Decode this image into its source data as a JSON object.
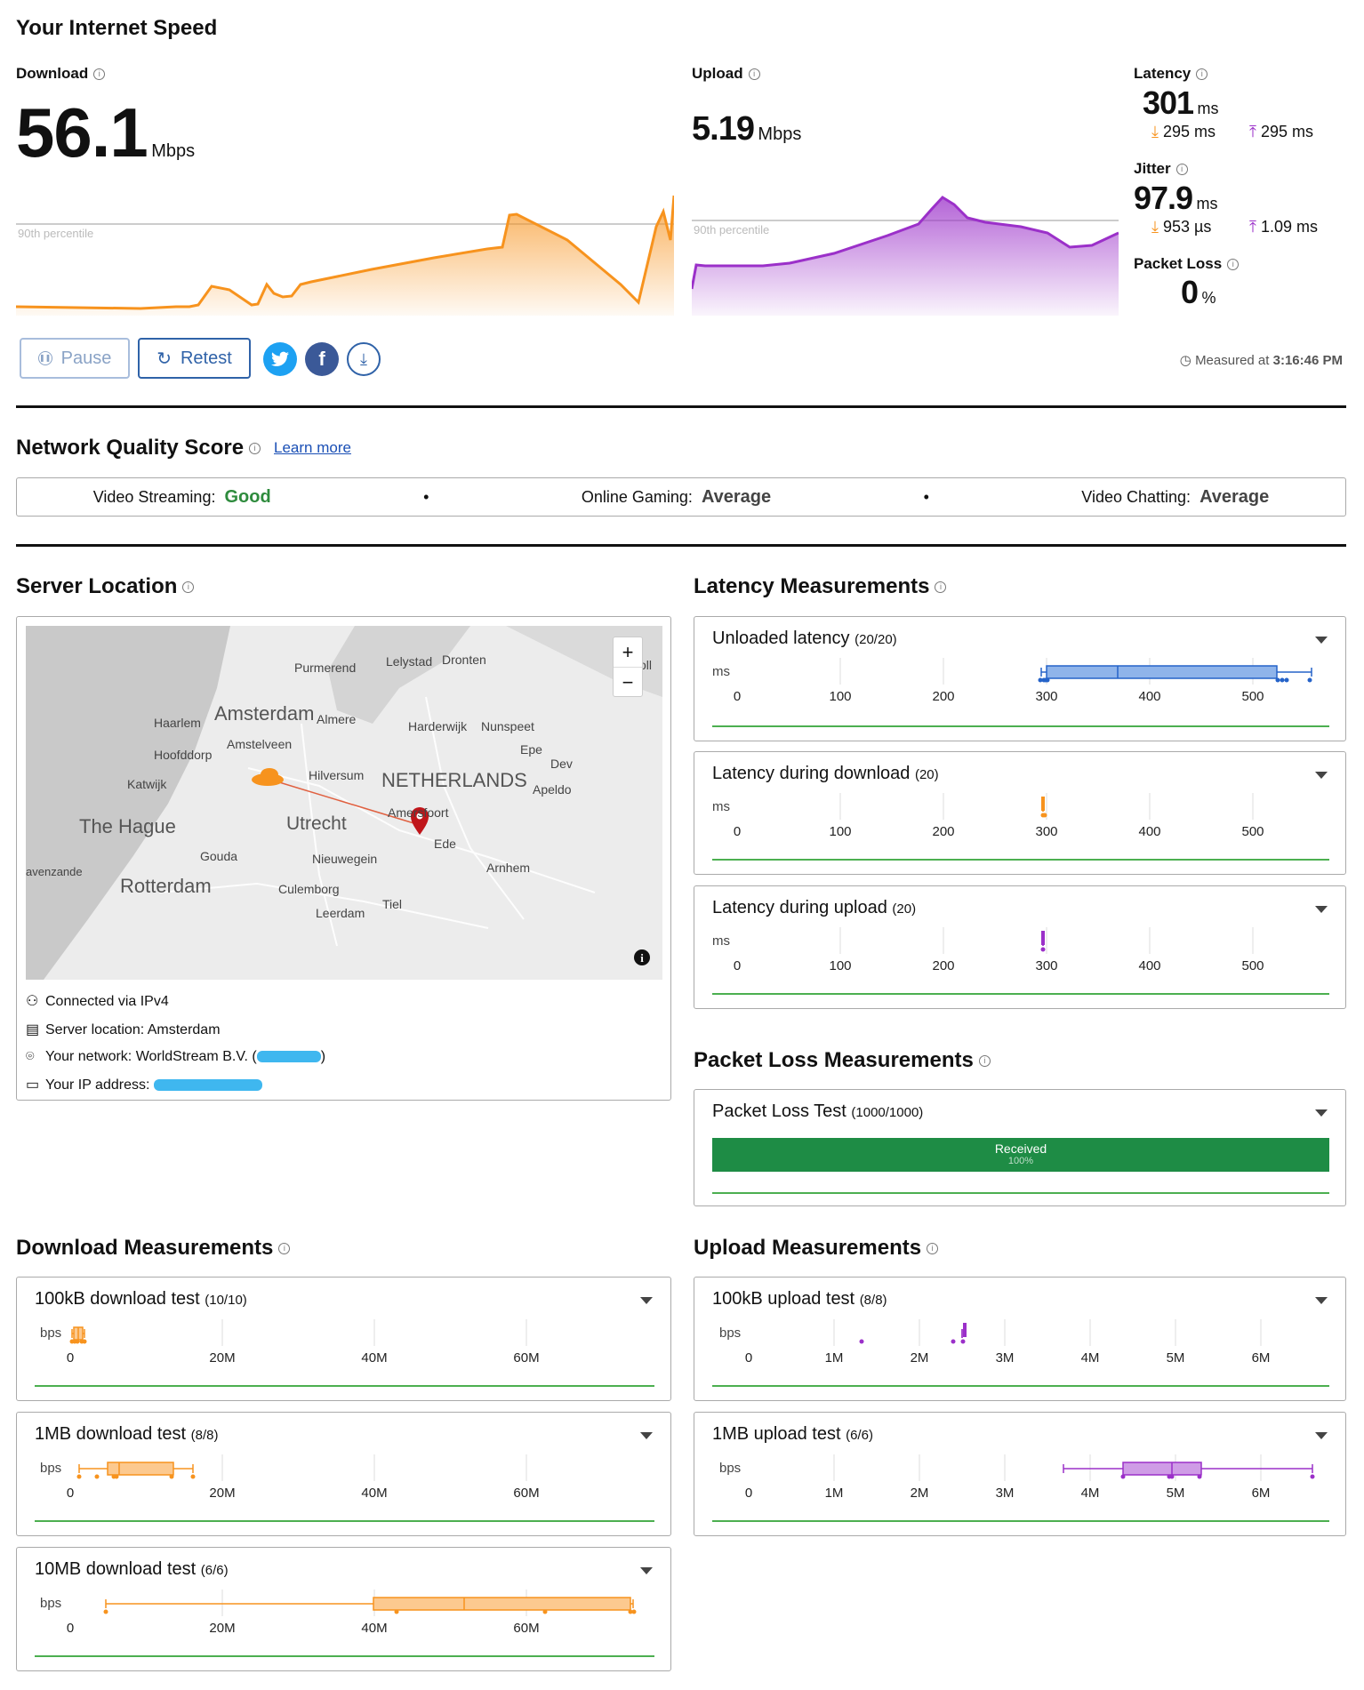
{
  "header": {
    "title": "Your Internet Speed",
    "download_label": "Download",
    "download_value": "56.1",
    "download_unit": "Mbps",
    "upload_label": "Upload",
    "upload_value": "5.19",
    "upload_unit": "Mbps",
    "percentile_label": "90th percentile",
    "latency_label": "Latency",
    "latency_value": "301",
    "latency_unit": "ms",
    "latency_down": "295 ms",
    "latency_up": "295 ms",
    "jitter_label": "Jitter",
    "jitter_value": "97.9",
    "jitter_unit": "ms",
    "jitter_down": "953 µs",
    "jitter_up": "1.09 ms",
    "packet_loss_label": "Packet Loss",
    "packet_loss_value": "0",
    "packet_loss_unit": "%",
    "pause_label": "Pause",
    "retest_label": "Retest",
    "measured_label": "Measured at",
    "measured_time": "3:16:46 PM"
  },
  "nqs": {
    "title": "Network Quality Score",
    "learn_more": "Learn more",
    "items": [
      {
        "label": "Video Streaming:",
        "value": "Good",
        "color": "#2e8b3d"
      },
      {
        "label": "Online Gaming:",
        "value": "Average",
        "color": "#444444"
      },
      {
        "label": "Video Chatting:",
        "value": "Average",
        "color": "#444444"
      }
    ]
  },
  "server": {
    "title": "Server Location",
    "map_labels": [
      "Purmerend",
      "Lelystad",
      "Dronten",
      "Haarlem",
      "Amsterdam",
      "Almere",
      "Harderwijk",
      "Nunspeet",
      "Hoofddorp",
      "Amstelveen",
      "Epe",
      "Katwijk",
      "Hilversum",
      "NETHERLANDS",
      "Apeldo",
      "Dev",
      "The Hague",
      "Utrecht",
      "Amersfoort",
      "Ede",
      "Gouda",
      "Nieuwegein",
      "avenzande",
      "Rotterdam",
      "Culemborg",
      "Arnhem",
      "Tiel",
      "Leerdam",
      "oll"
    ],
    "zoom_in": "+",
    "zoom_out": "−",
    "connected": "Connected via IPv4",
    "location": "Server location: Amsterdam",
    "network_prefix": "Your network: WorldStream B.V. (",
    "network_suffix": ")",
    "ip_prefix": "Your IP address:"
  },
  "latency": {
    "title": "Latency Measurements",
    "axis_unit": "ms",
    "ticks": [
      "0",
      "100",
      "200",
      "300",
      "400",
      "500"
    ],
    "cards": [
      {
        "title": "Unloaded latency",
        "count": "(20/20)"
      },
      {
        "title": "Latency during download",
        "count": "(20)"
      },
      {
        "title": "Latency during upload",
        "count": "(20)"
      }
    ]
  },
  "packet_loss": {
    "title": "Packet Loss Measurements",
    "card_title": "Packet Loss Test",
    "card_count": "(1000/1000)",
    "bar_label": "Received",
    "bar_pct": "100%",
    "received_fraction": 1.0
  },
  "download": {
    "title": "Download Measurements",
    "axis_unit": "bps",
    "ticks": [
      "0",
      "20M",
      "40M",
      "60M"
    ],
    "cards": [
      {
        "title": "100kB download test",
        "count": "(10/10)"
      },
      {
        "title": "1MB download test",
        "count": "(8/8)"
      },
      {
        "title": "10MB download test",
        "count": "(6/6)"
      }
    ]
  },
  "upload": {
    "title": "Upload Measurements",
    "axis_unit": "bps",
    "ticks": [
      "0",
      "1M",
      "2M",
      "3M",
      "4M",
      "5M",
      "6M"
    ],
    "cards": [
      {
        "title": "100kB upload test",
        "count": "(8/8)"
      },
      {
        "title": "1MB upload test",
        "count": "(6/6)"
      }
    ]
  },
  "colors": {
    "download": "#f7931e",
    "upload": "#9b30c9",
    "latency_box": "#2563c9",
    "green": "#1e8c45",
    "link": "#1a4fb5"
  }
}
